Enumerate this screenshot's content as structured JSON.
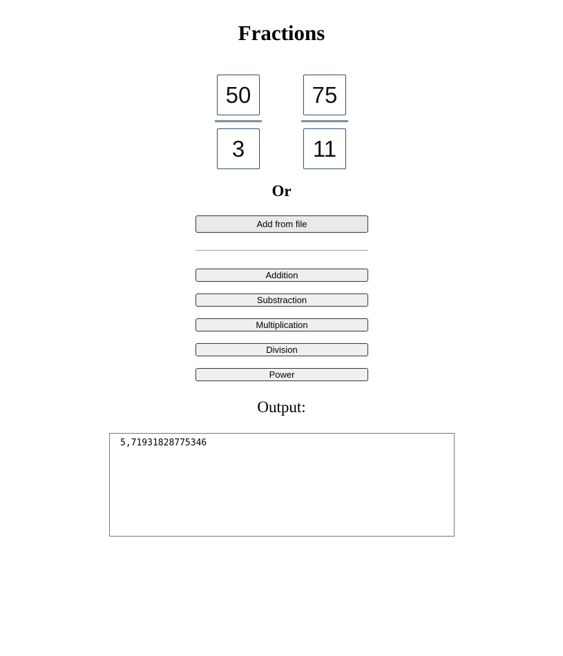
{
  "title": "Fractions",
  "fractions": [
    {
      "numerator": "50",
      "denominator": "3"
    },
    {
      "numerator": "75",
      "denominator": "11"
    }
  ],
  "or_label": "Or",
  "file_button_label": "Add from file",
  "operations": [
    {
      "label": "Addition"
    },
    {
      "label": "Substraction"
    },
    {
      "label": "Multiplication"
    },
    {
      "label": "Division"
    },
    {
      "label": "Power"
    }
  ],
  "output_label": "Output:",
  "output_value": "5,71931828775346",
  "colors": {
    "fraction_bar": "#7a8fa3",
    "input_border": "#2f4f6f",
    "button_bg": "#efefef"
  }
}
